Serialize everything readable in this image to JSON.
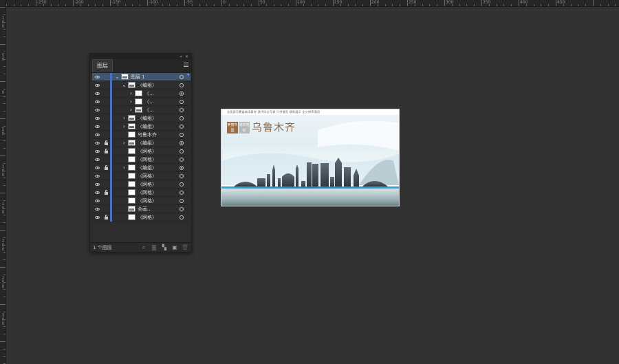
{
  "ruler_top_labels": [
    "-250",
    "-200",
    "-150",
    "-100",
    "-50",
    "0",
    "50",
    "100",
    "150",
    "200",
    "250",
    "300",
    "350",
    "400",
    "450"
  ],
  "ruler_left_labels": [
    "1 0 0",
    "5 0",
    "0",
    "5 0",
    "1 0 0",
    "1 5 0",
    "2 0 0",
    "2 5 0",
    "3 0 0"
  ],
  "panel": {
    "collapse_glyph": "«",
    "close_glyph": "×",
    "tab_label": "图层",
    "layers": [
      {
        "name": "图层 1",
        "twirl": "⌄",
        "thumb": "sky",
        "lock": false,
        "target": "ring",
        "selected": true,
        "indent": 0
      },
      {
        "name": "〈编组〉",
        "twirl": "⌄",
        "thumb": "sky",
        "lock": false,
        "target": "ring",
        "selected": false,
        "indent": 1
      },
      {
        "name": "〈...",
        "twirl": "›",
        "thumb": "plain",
        "lock": false,
        "target": "dot",
        "selected": false,
        "indent": 2
      },
      {
        "name": "〈...",
        "twirl": "›",
        "thumb": "plain",
        "lock": false,
        "target": "ring",
        "selected": false,
        "indent": 2
      },
      {
        "name": "〈...",
        "twirl": "›",
        "thumb": "sky",
        "lock": false,
        "target": "ring",
        "selected": false,
        "indent": 2
      },
      {
        "name": "〈编组〉",
        "twirl": "›",
        "thumb": "sky",
        "lock": false,
        "target": "ring",
        "selected": false,
        "indent": 1
      },
      {
        "name": "〈编组〉",
        "twirl": "›",
        "thumb": "sky",
        "lock": false,
        "target": "ring",
        "selected": false,
        "indent": 1
      },
      {
        "name": "乌鲁木齐",
        "twirl": "",
        "thumb": "plain",
        "lock": false,
        "target": "ring",
        "selected": false,
        "indent": 1
      },
      {
        "name": "〈编组〉",
        "twirl": "›",
        "thumb": "sky",
        "lock": true,
        "target": "dot",
        "selected": false,
        "indent": 1
      },
      {
        "name": "〈网格〉",
        "twirl": "",
        "thumb": "plain",
        "lock": true,
        "target": "ring",
        "selected": false,
        "indent": 1
      },
      {
        "name": "〈网格〉",
        "twirl": "",
        "thumb": "plain",
        "lock": false,
        "target": "ring",
        "selected": false,
        "indent": 1
      },
      {
        "name": "〈编组〉",
        "twirl": "›",
        "thumb": "plain",
        "lock": true,
        "target": "dot",
        "selected": false,
        "indent": 1
      },
      {
        "name": "〈网格〉",
        "twirl": "",
        "thumb": "plain",
        "lock": false,
        "target": "ring",
        "selected": false,
        "indent": 1
      },
      {
        "name": "〈网格〉",
        "twirl": "",
        "thumb": "plain",
        "lock": false,
        "target": "ring",
        "selected": false,
        "indent": 1
      },
      {
        "name": "〈网格〉",
        "twirl": "",
        "thumb": "plain",
        "lock": true,
        "target": "ring",
        "selected": false,
        "indent": 1
      },
      {
        "name": "〈网格〉",
        "twirl": "",
        "thumb": "plain",
        "lock": false,
        "target": "ring",
        "selected": false,
        "indent": 1
      },
      {
        "name": "全画...",
        "twirl": "",
        "thumb": "sky",
        "lock": false,
        "target": "ring",
        "selected": false,
        "indent": 1
      },
      {
        "name": "〈网格〉",
        "twirl": "",
        "thumb": "plain",
        "lock": true,
        "target": "ring",
        "selected": false,
        "indent": 1
      }
    ],
    "footer": {
      "count_label": "1 个图层",
      "icons": [
        {
          "name": "search-layer-icon",
          "glyph": "⌕",
          "dim": false
        },
        {
          "name": "make-clipping-mask-icon",
          "glyph": "◙",
          "dim": true
        },
        {
          "name": "new-sublayer-icon",
          "glyph": "▚",
          "dim": false
        },
        {
          "name": "new-layer-icon",
          "glyph": "▣",
          "dim": false
        },
        {
          "name": "delete-layer-icon",
          "glyph": "🗑",
          "dim": true
        }
      ]
    }
  },
  "artboard": {
    "caption": "全画面可覆盖商用素材  源代码全可调  只供借用  精致展示  全分辨率通用",
    "badge_a": "美丽中国",
    "badge_b": "城市地标",
    "city_name": "乌鲁木齐"
  },
  "colors": {
    "layer_color_bar": "#4a6fc2",
    "selected_row": "#44566c",
    "accent_band": "#1c7ec2",
    "city_name": "#8a6a4a"
  }
}
